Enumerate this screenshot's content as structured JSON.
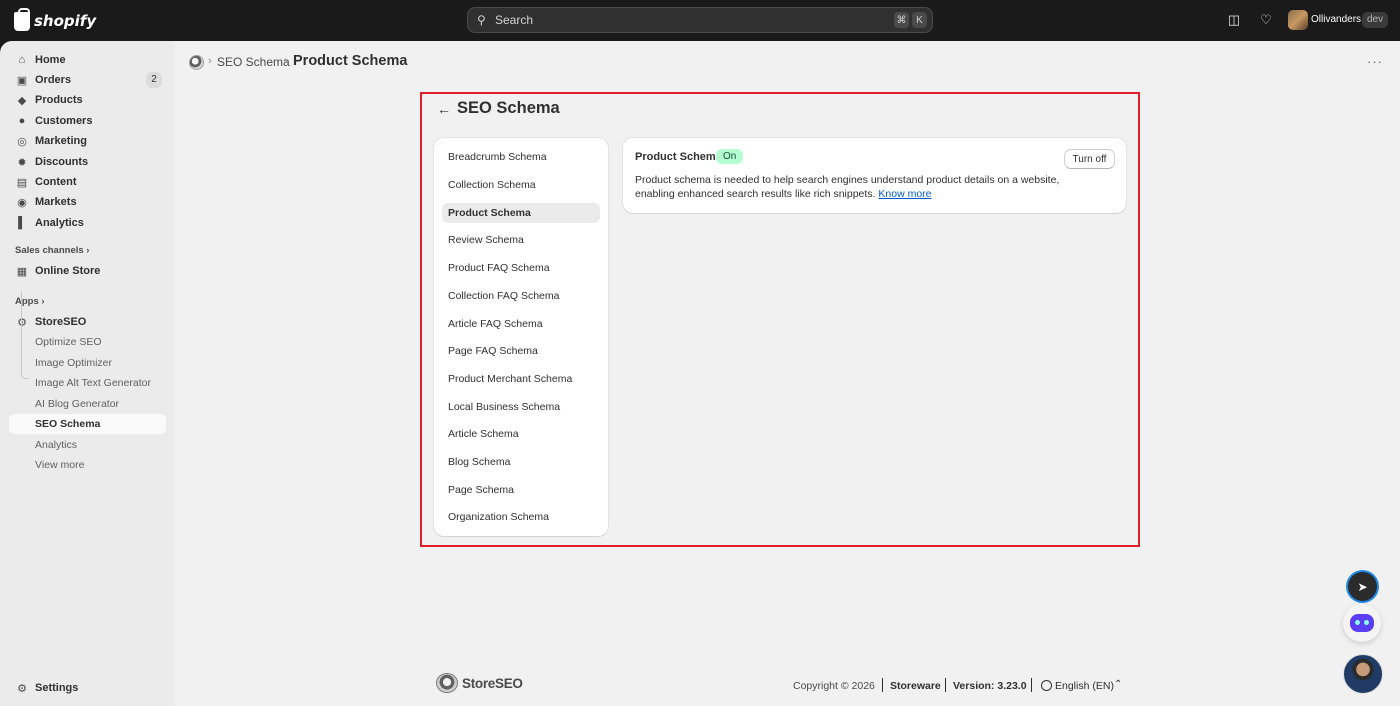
{
  "topbar": {
    "brand": "shopify",
    "search_placeholder": "Search",
    "shortcut_keys": [
      "⌘",
      "K"
    ],
    "store_name": "Ollivanders",
    "store_badge": "dev"
  },
  "sidebar": {
    "main_items": [
      {
        "label": "Home",
        "icon": "home-icon"
      },
      {
        "label": "Orders",
        "icon": "orders-icon",
        "count": "2"
      },
      {
        "label": "Products",
        "icon": "tag-icon"
      },
      {
        "label": "Customers",
        "icon": "person-icon"
      },
      {
        "label": "Marketing",
        "icon": "target-icon"
      },
      {
        "label": "Discounts",
        "icon": "discount-icon"
      },
      {
        "label": "Content",
        "icon": "content-icon"
      },
      {
        "label": "Markets",
        "icon": "globe-icon"
      },
      {
        "label": "Analytics",
        "icon": "bar-chart-icon"
      }
    ],
    "sales_channels_label": "Sales channels",
    "online_store_label": "Online Store",
    "apps_label": "Apps",
    "app_name": "StoreSEO",
    "app_sub_items": [
      "Optimize SEO",
      "Image Optimizer",
      "Image Alt Text Generator",
      "AI Blog Generator",
      "SEO Schema",
      "Analytics",
      "View more"
    ],
    "active_sub_item": "SEO Schema",
    "settings_label": "Settings"
  },
  "breadcrumb": {
    "parent": "SEO Schema",
    "current": "Product Schema"
  },
  "page": {
    "heading": "SEO Schema",
    "schema_menu": [
      "Breadcrumb Schema",
      "Collection Schema",
      "Product Schema",
      "Review Schema",
      "Product FAQ Schema",
      "Collection FAQ Schema",
      "Article FAQ Schema",
      "Page FAQ Schema",
      "Product Merchant Schema",
      "Local Business Schema",
      "Article Schema",
      "Blog Schema",
      "Page Schema",
      "Organization Schema"
    ],
    "active_schema": "Product Schema",
    "detail": {
      "title": "Product Schema",
      "status": "On",
      "button": "Turn off",
      "description_line1": "Product schema is needed to help search engines understand product details on a website,",
      "description_line2": "enabling enhanced search results like rich snippets.",
      "link": "Know more"
    }
  },
  "footer": {
    "logo_text": "StoreSEO",
    "copyright": "Copyright © 2026",
    "company": "Storeware",
    "version": "Version: 3.23.0",
    "language": "English (EN)"
  },
  "colors": {
    "highlight_frame": "#e11d2b",
    "status_badge_bg": "#b4fed2",
    "link": "#005bd3"
  }
}
